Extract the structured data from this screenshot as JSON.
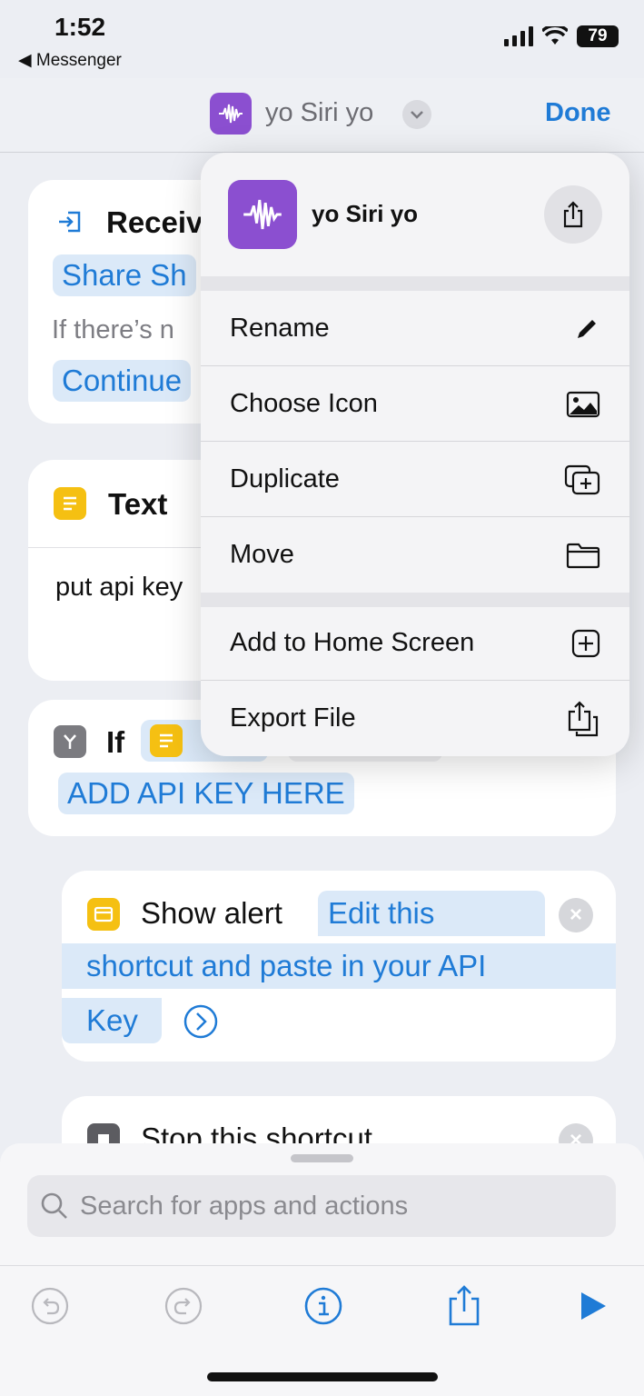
{
  "status": {
    "time": "1:52",
    "back_app": "◀ Messenger",
    "battery": "79"
  },
  "nav": {
    "title": "yo Siri yo",
    "done": "Done"
  },
  "cards": {
    "receive": {
      "title": "Receiv",
      "pill1": "Share Sh",
      "gray": "If there’s n",
      "pill2": "Continue"
    },
    "text": {
      "title": "Text",
      "body": "put api key"
    },
    "if": {
      "title": "If",
      "value": "ADD API KEY HERE"
    },
    "alert": {
      "title": "Show alert",
      "line1": "Edit this",
      "line2": "shortcut and paste in your API",
      "line3": "Key"
    },
    "stop": {
      "title": "Stop this shortcut"
    }
  },
  "menu": {
    "name": "yo Siri yo",
    "items": [
      {
        "label": "Rename",
        "icon": "pencil-icon"
      },
      {
        "label": "Choose Icon",
        "icon": "photo-icon"
      },
      {
        "label": "Duplicate",
        "icon": "duplicate-icon"
      },
      {
        "label": "Move",
        "icon": "folder-icon"
      },
      {
        "label": "Add to Home Screen",
        "icon": "plus-square-icon"
      },
      {
        "label": "Export File",
        "icon": "export-icon"
      }
    ]
  },
  "search": {
    "placeholder": "Search for apps and actions"
  },
  "colors": {
    "accent": "#1f7bd6",
    "shortcut_icon": "#8b4fd0",
    "action_yellow": "#f5c012"
  }
}
